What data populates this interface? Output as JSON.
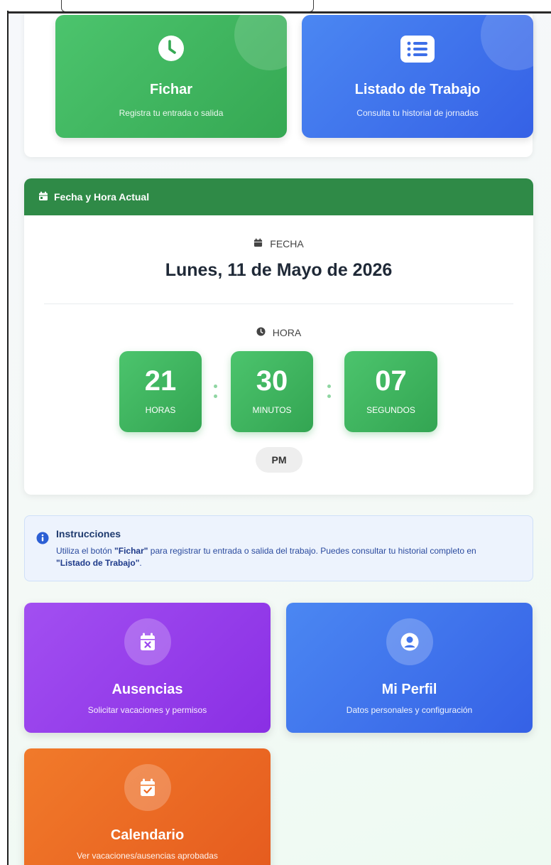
{
  "actions": {
    "fichar": {
      "title": "Fichar",
      "subtitle": "Registra tu entrada o salida",
      "icon": "clock-icon"
    },
    "listado": {
      "title": "Listado de Trabajo",
      "subtitle": "Consulta tu historial de jornadas",
      "icon": "list-icon"
    }
  },
  "datetime": {
    "header": "Fecha y Hora Actual",
    "date_label": "FECHA",
    "date_value": "Lunes, 11 de Mayo de 2026",
    "time_label": "HORA",
    "hours": "21",
    "hours_label": "HORAS",
    "minutes": "30",
    "minutes_label": "MINUTOS",
    "seconds": "07",
    "seconds_label": "SEGUNDOS",
    "ampm": "PM"
  },
  "instructions": {
    "title": "Instrucciones",
    "text_1": "Utiliza el botón ",
    "bold_1": "\"Fichar\"",
    "text_2": " para registrar tu entrada o salida del trabajo. Puedes consultar tu historial completo en ",
    "bold_2": "\"Listado de Trabajo\"",
    "text_3": "."
  },
  "features": {
    "ausencias": {
      "title": "Ausencias",
      "subtitle": "Solicitar vacaciones y permisos",
      "icon": "calendar-x-icon"
    },
    "perfil": {
      "title": "Mi Perfil",
      "subtitle": "Datos personales y configuración",
      "icon": "user-circle-icon"
    },
    "calendario": {
      "title": "Calendario",
      "subtitle": "Ver vacaciones/ausencias aprobadas",
      "icon": "calendar-check-icon"
    }
  },
  "colors": {
    "green": "#35a853",
    "header_green": "#2f8a47",
    "blue": "#3561e6",
    "purple": "#8a2fe4",
    "orange": "#e55a1e"
  }
}
